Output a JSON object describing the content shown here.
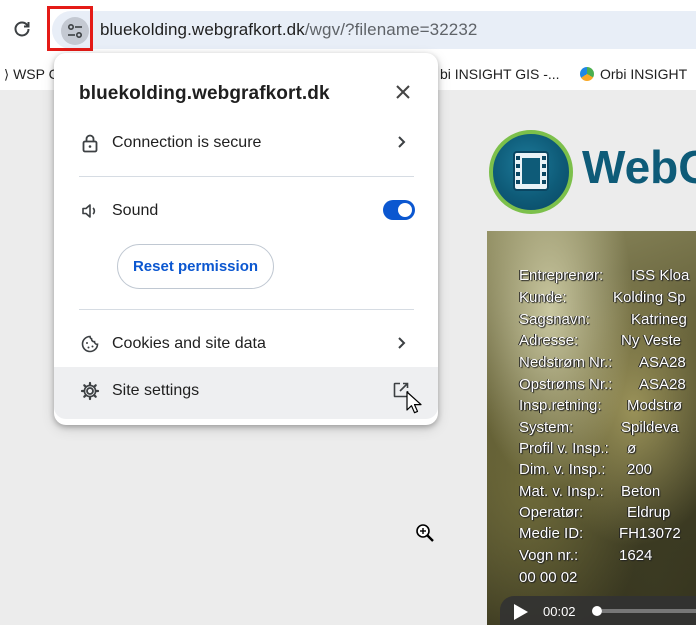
{
  "browser": {
    "url_host": "bluekolding.webgrafkort.dk",
    "url_path": "/wgv/?filename=32232",
    "icons": {
      "reload": "reload-icon",
      "site_info": "tune-icon"
    }
  },
  "bookmarks": [
    {
      "label": "WSP C",
      "icon": "wsp-icon"
    },
    {
      "label": "bi INSIGHT GIS -...",
      "icon": "orbi-icon"
    },
    {
      "label": "Orbi INSIGHT",
      "icon": "orbi-icon"
    }
  ],
  "popup": {
    "title": "bluekolding.webgrafkort.dk",
    "connection": {
      "label": "Connection is secure",
      "icon": "lock-icon"
    },
    "sound": {
      "label": "Sound",
      "icon": "speaker-icon",
      "enabled": true
    },
    "reset_button": "Reset permission",
    "cookies": {
      "label": "Cookies and site data",
      "icon": "cookie-icon"
    },
    "site_settings": {
      "label": "Site settings",
      "icon": "gear-icon"
    },
    "colors": {
      "accent": "#0b57d0",
      "highlight": "#eeeff1"
    }
  },
  "page": {
    "logo_text": "WebG",
    "video_overlay": [
      {
        "label": "Entreprenør:",
        "value": "ISS Kloa"
      },
      {
        "label": "Kunde:",
        "value": "Kolding Sp"
      },
      {
        "label": "Sagsnavn:",
        "value": "Katrineg"
      },
      {
        "label": "Adresse:",
        "value": "Ny Veste"
      },
      {
        "label": "Nedstrøm Nr.:",
        "value": "ASA28"
      },
      {
        "label": "Opstrøms Nr.:",
        "value": "ASA28"
      },
      {
        "label": "Insp.retning:",
        "value": "Modstrø"
      },
      {
        "label": "System:",
        "value": "Spildeva"
      },
      {
        "label": "Profil v. Insp.:",
        "value": "ø"
      },
      {
        "label": "Dim. v. Insp.:",
        "value": "200"
      },
      {
        "label": "Mat. v. Insp.:",
        "value": "Beton"
      },
      {
        "label": "Operatør:",
        "value": "Eldrup"
      },
      {
        "label": "Medie ID:",
        "value": "FH13072"
      },
      {
        "label": "Vogn nr.:",
        "value": "1624"
      },
      {
        "label": "00 00 02",
        "value": ""
      }
    ],
    "player": {
      "current_time": "00:02"
    }
  }
}
